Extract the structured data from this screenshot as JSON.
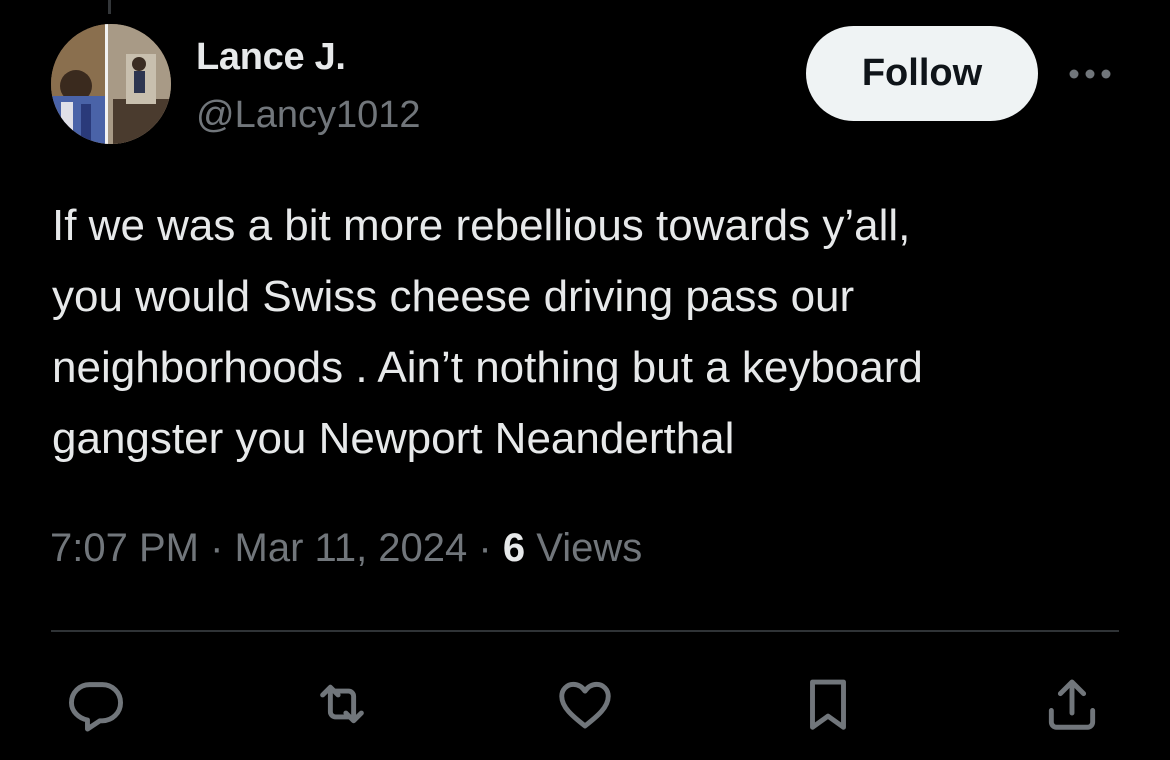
{
  "author": {
    "display_name": "Lance J.",
    "handle": "@Lancy1012",
    "avatar_icon": "profile-photo"
  },
  "follow_label": "Follow",
  "more_icon": "more-horizontal-icon",
  "tweet": {
    "lines": [
      "If we was a bit more rebellious towards y’all,",
      "you would Swiss cheese driving pass our",
      "neighborhoods . Ain’t nothing but a keyboard",
      "gangster you Newport Neanderthal"
    ]
  },
  "meta": {
    "time": "7:07 PM",
    "separator": "·",
    "date": "Mar 11, 2024",
    "views_count": "6",
    "views_label": "Views"
  },
  "actions": [
    {
      "icon": "reply-icon"
    },
    {
      "icon": "retweet-icon"
    },
    {
      "icon": "like-icon"
    },
    {
      "icon": "bookmark-icon"
    },
    {
      "icon": "share-icon"
    }
  ],
  "colors": {
    "background": "#000000",
    "primary_text": "#e7e9ea",
    "secondary_text": "#71767b",
    "divider": "#2f3336",
    "follow_bg": "#eff3f4",
    "follow_text": "#0f1419"
  }
}
